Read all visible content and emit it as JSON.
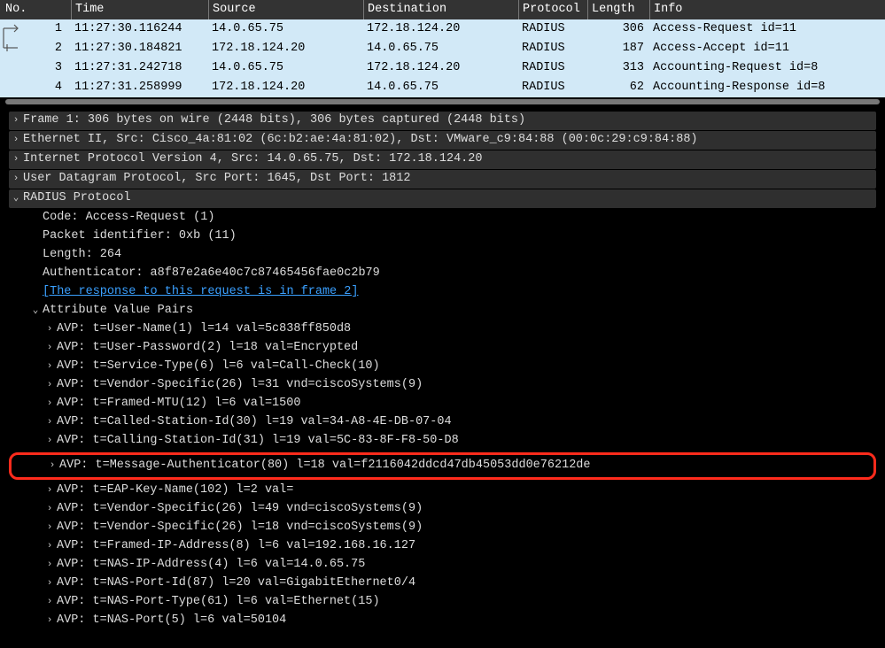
{
  "columns": {
    "no": "No.",
    "time": "Time",
    "source": "Source",
    "destination": "Destination",
    "protocol": "Protocol",
    "length": "Length",
    "info": "Info"
  },
  "packets": [
    {
      "no": "1",
      "time": "11:27:30.116244",
      "src": "14.0.65.75",
      "dst": "172.18.124.20",
      "proto": "RADIUS",
      "len": "306",
      "info": "Access-Request id=11"
    },
    {
      "no": "2",
      "time": "11:27:30.184821",
      "src": "172.18.124.20",
      "dst": "14.0.65.75",
      "proto": "RADIUS",
      "len": "187",
      "info": "Access-Accept id=11"
    },
    {
      "no": "3",
      "time": "11:27:31.242718",
      "src": "14.0.65.75",
      "dst": "172.18.124.20",
      "proto": "RADIUS",
      "len": "313",
      "info": "Accounting-Request id=8"
    },
    {
      "no": "4",
      "time": "11:27:31.258999",
      "src": "172.18.124.20",
      "dst": "14.0.65.75",
      "proto": "RADIUS",
      "len": "62",
      "info": "Accounting-Response id=8"
    }
  ],
  "details": {
    "frame": "Frame 1: 306 bytes on wire (2448 bits), 306 bytes captured (2448 bits)",
    "eth": "Ethernet II, Src: Cisco_4a:81:02 (6c:b2:ae:4a:81:02), Dst: VMware_c9:84:88 (00:0c:29:c9:84:88)",
    "ip": "Internet Protocol Version 4, Src: 14.0.65.75, Dst: 172.18.124.20",
    "udp": "User Datagram Protocol, Src Port: 1645, Dst Port: 1812",
    "radius": "RADIUS Protocol",
    "code": "Code: Access-Request (1)",
    "pktid": "Packet identifier: 0xb (11)",
    "length": "Length: 264",
    "authenticator": "Authenticator: a8f87e2a6e40c7c87465456fae0c2b79",
    "responselink": "[The response to this request is in frame 2]",
    "avp_header": "Attribute Value Pairs",
    "avps": [
      "AVP: t=User-Name(1) l=14 val=5c838ff850d8",
      "AVP: t=User-Password(2) l=18 val=Encrypted",
      "AVP: t=Service-Type(6) l=6 val=Call-Check(10)",
      "AVP: t=Vendor-Specific(26) l=31 vnd=ciscoSystems(9)",
      "AVP: t=Framed-MTU(12) l=6 val=1500",
      "AVP: t=Called-Station-Id(30) l=19 val=34-A8-4E-DB-07-04",
      "AVP: t=Calling-Station-Id(31) l=19 val=5C-83-8F-F8-50-D8",
      "AVP: t=Message-Authenticator(80) l=18 val=f2116042ddcd47db45053dd0e76212de",
      "AVP: t=EAP-Key-Name(102) l=2 val=",
      "AVP: t=Vendor-Specific(26) l=49 vnd=ciscoSystems(9)",
      "AVP: t=Vendor-Specific(26) l=18 vnd=ciscoSystems(9)",
      "AVP: t=Framed-IP-Address(8) l=6 val=192.168.16.127",
      "AVP: t=NAS-IP-Address(4) l=6 val=14.0.65.75",
      "AVP: t=NAS-Port-Id(87) l=20 val=GigabitEthernet0/4",
      "AVP: t=NAS-Port-Type(61) l=6 val=Ethernet(15)",
      "AVP: t=NAS-Port(5) l=6 val=50104"
    ],
    "highlight_index": 7
  }
}
